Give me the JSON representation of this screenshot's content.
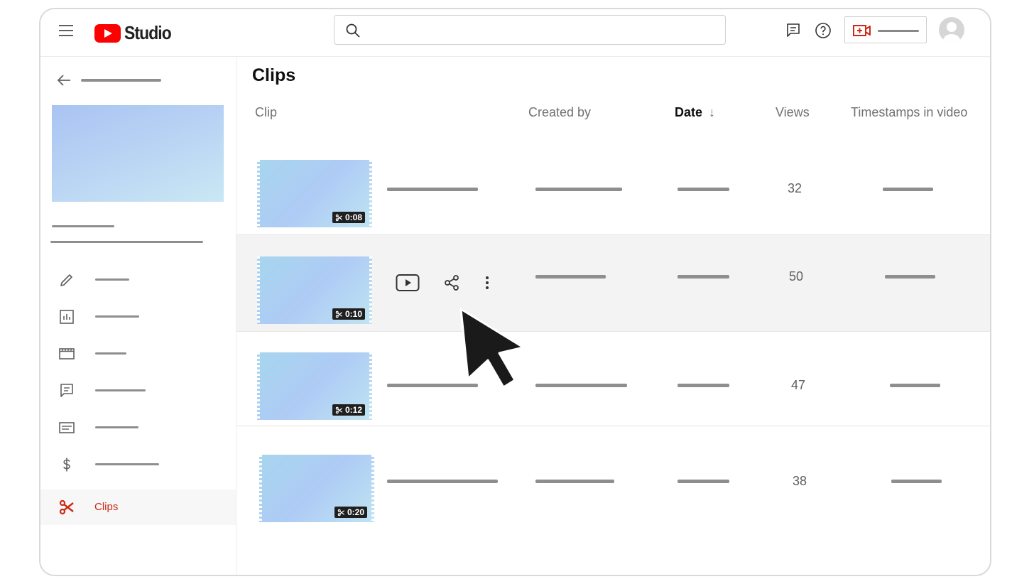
{
  "app": {
    "logo_text": "Studio"
  },
  "header": {
    "search": {
      "placeholder": "",
      "value": ""
    },
    "icons": [
      "menu-icon",
      "search-icon",
      "feedback-icon",
      "help-icon",
      "create-video-icon",
      "avatar"
    ]
  },
  "sidebar": {
    "nav": [
      {
        "icon": "pencil-icon",
        "label": ""
      },
      {
        "icon": "analytics-icon",
        "label": ""
      },
      {
        "icon": "editor-icon",
        "label": ""
      },
      {
        "icon": "comments-icon",
        "label": ""
      },
      {
        "icon": "subtitles-icon",
        "label": ""
      },
      {
        "icon": "monetization-icon",
        "label": ""
      },
      {
        "icon": "scissors-icon",
        "label": "Clips"
      }
    ]
  },
  "main": {
    "title": "Clips",
    "columns": {
      "clip": "Clip",
      "created_by": "Created by",
      "date": "Date",
      "date_sort_icon": "↓",
      "views": "Views",
      "timestamps": "Timestamps in video"
    },
    "rows": [
      {
        "duration": "0:08",
        "views": "32"
      },
      {
        "duration": "0:10",
        "views": "50",
        "actions": [
          "play-icon",
          "share-icon",
          "more-icon"
        ]
      },
      {
        "duration": "0:12",
        "views": "47"
      },
      {
        "duration": "0:20",
        "views": "38"
      }
    ]
  },
  "colors": {
    "accent": "#cc2a14",
    "brand_red": "#ff0000"
  }
}
